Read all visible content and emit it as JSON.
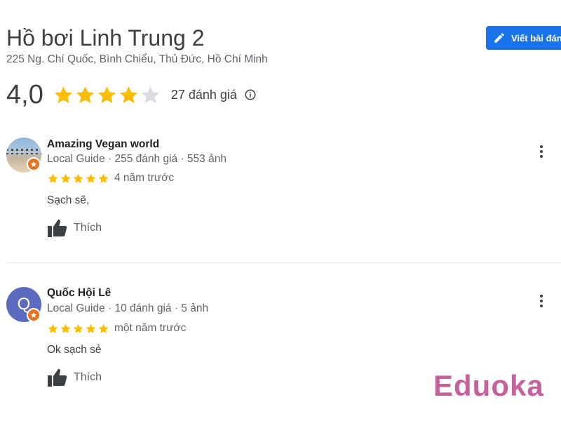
{
  "place": {
    "title": "Hồ bơi Linh Trung 2",
    "address": "225 Ng. Chí Quốc, Bình Chiểu, Thủ Đức, Hồ Chí Minh",
    "rating": "4,0",
    "rating_value": 4,
    "review_count": "27 đánh giá"
  },
  "actions": {
    "write_review": "Viết bài đánh giá"
  },
  "colors": {
    "star_filled": "#fbbc04",
    "star_empty": "#dadce0",
    "accent": "#1a73e8",
    "badge": "#e8711c",
    "watermark": "#c0508f"
  },
  "reviews": [
    {
      "name": "Amazing Vegan world",
      "meta": "Local Guide · 255 đánh giá · 553 ảnh",
      "stars": 5,
      "time": "4 năm trước",
      "text": "Sạch sẽ,",
      "like_label": "Thích",
      "avatar_type": "photo"
    },
    {
      "name": "Quốc Hội Lê",
      "meta": "Local Guide · 10 đánh giá · 5 ảnh",
      "stars": 5,
      "time": "một năm trước",
      "text": "Ok sạch sẻ",
      "like_label": "Thích",
      "avatar_type": "letter",
      "avatar_letter": "Q"
    }
  ],
  "watermark": "Eduoka"
}
